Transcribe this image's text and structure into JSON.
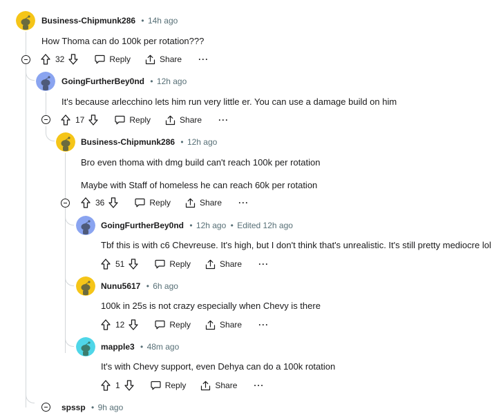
{
  "comments": [
    {
      "author": "Business-Chipmunk286",
      "time": "14h ago",
      "text": "How Thoma can do 100k per rotation???",
      "score": "32",
      "avatar_color": "#f5c518"
    },
    {
      "author": "GoingFurtherBey0nd",
      "time": "12h ago",
      "text": "It's because arlecchino lets him run very little er. You can use a damage build on him",
      "score": "17",
      "avatar_color": "#8aa4f0"
    },
    {
      "author": "Business-Chipmunk286",
      "time": "12h ago",
      "text": "Bro even thoma with dmg build can't reach 100k per rotation",
      "text2": "Maybe with Staff of homeless he can reach 60k per rotation",
      "score": "36",
      "avatar_color": "#f5c518"
    },
    {
      "author": "GoingFurtherBey0nd",
      "time": "12h ago",
      "edited": "Edited 12h ago",
      "text": "Tbf this is with c6 Chevreuse. It's high, but I don't think that's unrealistic. It's still pretty mediocre lol",
      "score": "51",
      "avatar_color": "#8aa4f0"
    },
    {
      "author": "Nunu5617",
      "time": "6h ago",
      "text": "100k in 25s is not crazy especially when Chevy is there",
      "score": "12",
      "avatar_color": "#f5c518"
    },
    {
      "author": "mapple3",
      "time": "48m ago",
      "text": "It's with Chevy support, even Dehya can do a 100k rotation",
      "score": "1",
      "avatar_color": "#4fd6e8"
    },
    {
      "author": "spssp",
      "time": "9h ago"
    }
  ],
  "actions": {
    "reply": "Reply",
    "share": "Share",
    "more": "···",
    "dot": "•"
  },
  "colors": {
    "thread_line": "#d2d6d9",
    "meta_gray": "#576f76",
    "text": "#1a1a1b"
  }
}
